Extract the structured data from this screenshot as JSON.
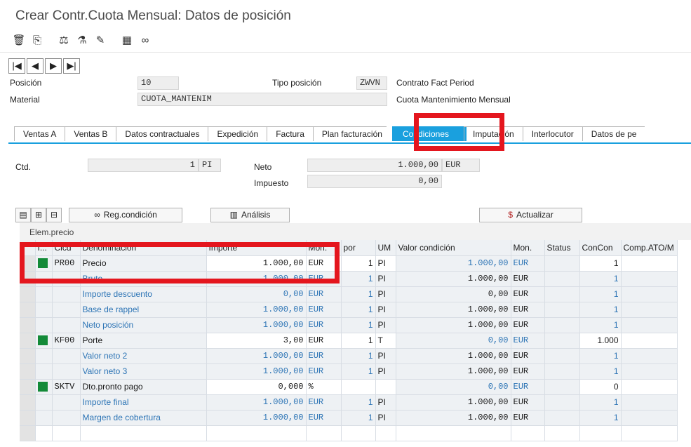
{
  "window": {
    "title": "Crear Contr.Cuota Mensual: Datos de posición"
  },
  "toolbar": {
    "icons": [
      "trash-icon",
      "copy-icon",
      "balance-icon",
      "flask-icon",
      "notepad-icon",
      "calculator-icon",
      "glasses-icon"
    ]
  },
  "header": {
    "posicion_label": "Posición",
    "posicion_value": "10",
    "tipo_label": "Tipo posición",
    "tipo_value": "ZWVN",
    "tipo_desc": "Contrato Fact Period",
    "material_label": "Material",
    "material_value": "CUOTA_MANTENIM",
    "material_desc": "Cuota Mantenimiento Mensual"
  },
  "tabs": [
    "Ventas A",
    "Ventas B",
    "Datos contractuales",
    "Expedición",
    "Factura",
    "Plan facturación",
    "Condiciones",
    "Imputación",
    "Interlocutor",
    "Datos de pe"
  ],
  "active_tab": "Condiciones",
  "qty": {
    "ctd_label": "Ctd.",
    "ctd_value": "1",
    "ctd_unit": "PI",
    "neto_label": "Neto",
    "neto_value": "1.000,00",
    "neto_cur": "EUR",
    "impuesto_label": "Impuesto",
    "impuesto_value": "0,00"
  },
  "buttons": {
    "regcondicion": "Reg.condición",
    "analisis": "Análisis",
    "actualizar": "Actualizar"
  },
  "grid": {
    "section_label": "Elem.precio",
    "columns": [
      "I...",
      "Clcd",
      "Denominación",
      "Importe",
      "Mon.",
      "por",
      "UM",
      "Valor condición",
      "Mon.",
      "Status",
      "ConCon",
      "Comp.ATO/M"
    ],
    "rows": [
      {
        "status": true,
        "clcd": "PR00",
        "denom": "Precio",
        "importe": "1.000,00",
        "mon": "EUR",
        "por": "1",
        "um": "PI",
        "valor": "1.000,00",
        "mon2": "EUR",
        "concon": "1",
        "editable": true,
        "blue": false
      },
      {
        "status": false,
        "clcd": "",
        "denom": "Bruto",
        "importe": "1.000,00",
        "mon": "EUR",
        "por": "1",
        "um": "PI",
        "valor": "1.000,00",
        "mon2": "EUR",
        "concon": "1",
        "editable": false,
        "blue": true
      },
      {
        "status": false,
        "clcd": "",
        "denom": "Importe descuento",
        "importe": "0,00",
        "mon": "EUR",
        "por": "1",
        "um": "PI",
        "valor": "0,00",
        "mon2": "EUR",
        "concon": "1",
        "editable": false,
        "blue": true
      },
      {
        "status": false,
        "clcd": "",
        "denom": "Base de rappel",
        "importe": "1.000,00",
        "mon": "EUR",
        "por": "1",
        "um": "PI",
        "valor": "1.000,00",
        "mon2": "EUR",
        "concon": "1",
        "editable": false,
        "blue": true
      },
      {
        "status": false,
        "clcd": "",
        "denom": "Neto posición",
        "importe": "1.000,00",
        "mon": "EUR",
        "por": "1",
        "um": "PI",
        "valor": "1.000,00",
        "mon2": "EUR",
        "concon": "1",
        "editable": false,
        "blue": true
      },
      {
        "status": true,
        "clcd": "KF00",
        "denom": "Porte",
        "importe": "3,00",
        "mon": "EUR",
        "por": "1",
        "um": "T",
        "valor": "0,00",
        "mon2": "EUR",
        "concon": "1.000",
        "editable": true,
        "blue": false
      },
      {
        "status": false,
        "clcd": "",
        "denom": "Valor neto 2",
        "importe": "1.000,00",
        "mon": "EUR",
        "por": "1",
        "um": "PI",
        "valor": "1.000,00",
        "mon2": "EUR",
        "concon": "1",
        "editable": false,
        "blue": true
      },
      {
        "status": false,
        "clcd": "",
        "denom": "Valor neto 3",
        "importe": "1.000,00",
        "mon": "EUR",
        "por": "1",
        "um": "PI",
        "valor": "1.000,00",
        "mon2": "EUR",
        "concon": "1",
        "editable": false,
        "blue": true
      },
      {
        "status": true,
        "clcd": "SKTV",
        "denom": "Dto.pronto pago",
        "importe": "0,000",
        "mon": "%",
        "por": "",
        "um": "",
        "valor": "0,00",
        "mon2": "EUR",
        "concon": "0",
        "editable": true,
        "blue": false
      },
      {
        "status": false,
        "clcd": "",
        "denom": "Importe final",
        "importe": "1.000,00",
        "mon": "EUR",
        "por": "1",
        "um": "PI",
        "valor": "1.000,00",
        "mon2": "EUR",
        "concon": "1",
        "editable": false,
        "blue": true
      },
      {
        "status": false,
        "clcd": "",
        "denom": "Margen de cobertura",
        "importe": "1.000,00",
        "mon": "EUR",
        "por": "1",
        "um": "PI",
        "valor": "1.000,00",
        "mon2": "EUR",
        "concon": "1",
        "editable": false,
        "blue": true
      }
    ]
  },
  "colors": {
    "accent": "#1aa0de",
    "highlight": "#e4161e",
    "status_green": "#138a38",
    "value_blue": "#2c74b5"
  }
}
